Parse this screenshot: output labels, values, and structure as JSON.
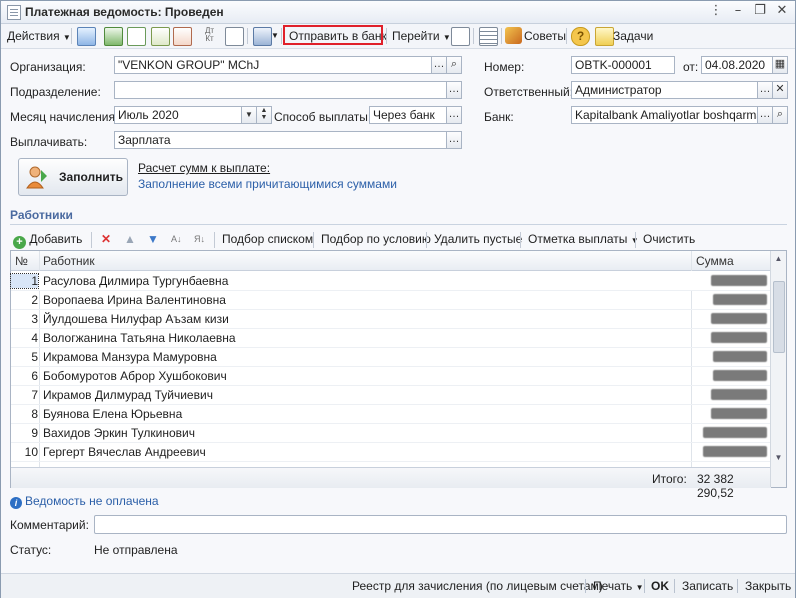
{
  "window": {
    "title": "Платежная ведомость: Проведен"
  },
  "toolbar": {
    "actions_label": "Действия",
    "send_to_bank_label": "Отправить в банк",
    "goto_label": "Перейти",
    "tips_label": "Советы",
    "tasks_label": "Задачи"
  },
  "form": {
    "organization_label": "Организация:",
    "organization_value": "\"VENKON GROUP\" MChJ",
    "department_label": "Подразделение:",
    "department_value": "",
    "month_label": "Месяц начисления:",
    "month_value": "Июль 2020",
    "payment_method_label": "Способ выплаты:",
    "payment_method_value": "Через банк",
    "pay_label": "Выплачивать:",
    "pay_value": "Зарплата",
    "number_label": "Номер:",
    "number_value": "OBTK-000001",
    "date_label": "от:",
    "date_value": "04.08.2020",
    "responsible_label": "Ответственный:",
    "responsible_value": "Администратор",
    "bank_label": "Банк:",
    "bank_value": "Kapitalbank Amaliyotlar boshqarmasi"
  },
  "fill": {
    "button_label": "Заполнить",
    "calc_link": "Расчет сумм к выплате:",
    "fill_desc": "Заполнение всеми причитающимися суммами"
  },
  "workers": {
    "section_title": "Работники",
    "toolbar": {
      "add": "Добавить",
      "select_list": "Подбор списком",
      "select_condition": "Подбор по условию",
      "delete_empty": "Удалить пустые",
      "payment_mark": "Отметка выплаты",
      "clear": "Очистить"
    },
    "columns": {
      "num": "№",
      "worker": "Работник",
      "sum": "Сумма"
    },
    "rows": [
      {
        "num": "1",
        "name": "Расулова Дилмира Тургунбаевна"
      },
      {
        "num": "2",
        "name": "Воропаева Ирина Валентиновна"
      },
      {
        "num": "3",
        "name": "Йулдошева Нилуфар Аъзам кизи"
      },
      {
        "num": "4",
        "name": "Вологжанина Татьяна Николаевна"
      },
      {
        "num": "5",
        "name": "Икрамова Манзура Мамуровна"
      },
      {
        "num": "6",
        "name": "Бобомуротов Аброр Хушбокович"
      },
      {
        "num": "7",
        "name": "Икрамов Дилмурад Туйчиевич"
      },
      {
        "num": "8",
        "name": "Буянова Елена Юрьевна"
      },
      {
        "num": "9",
        "name": "Вахидов Эркин Тулкинович"
      },
      {
        "num": "10",
        "name": "Гергерт Вячеслав Андреевич"
      }
    ],
    "total_label": "Итого:",
    "total_value": "32 382 290,52"
  },
  "info": {
    "not_paid": "Ведомость не оплачена"
  },
  "comment": {
    "label": "Комментарий:",
    "value": ""
  },
  "status": {
    "label": "Статус:",
    "value": "Не отправлена"
  },
  "bottom": {
    "registry": "Реестр для зачисления (по лицевым счетам)",
    "print": "Печать",
    "ok": "OK",
    "save": "Записать",
    "close": "Закрыть"
  }
}
